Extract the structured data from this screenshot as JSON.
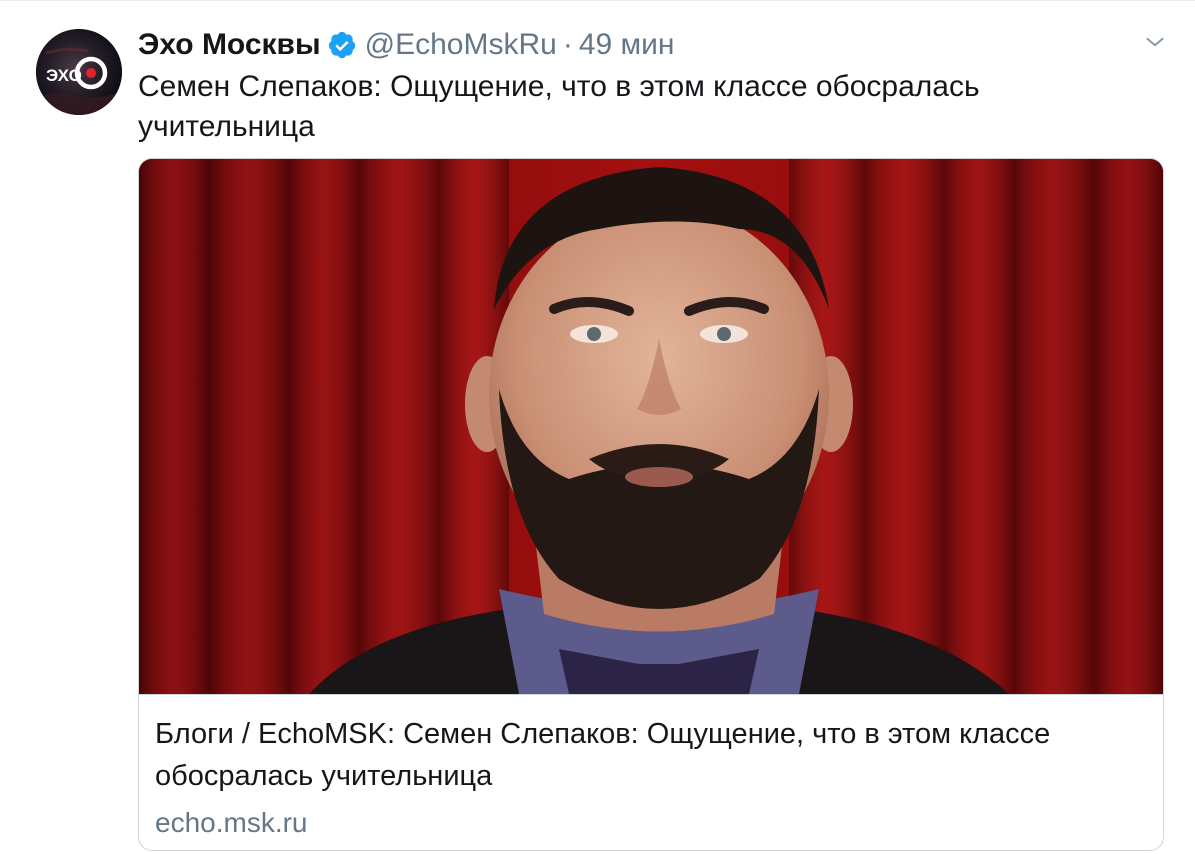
{
  "tweet": {
    "author_name": "Эхо Москвы",
    "handle": "@EchoMskRu",
    "separator": "·",
    "time": "49 мин",
    "text": "Семен Слепаков: Ощущение, что в этом классе обосралась учительница",
    "avatar_logo_text": "ЭХО",
    "icons": {
      "verified": "verified-badge-icon",
      "menu": "chevron-down-icon"
    }
  },
  "card": {
    "title": "Блоги / EchoMSK: Семен Слепаков: Ощущение, что в этом классе обосралась учительница",
    "domain": "echo.msk.ru"
  },
  "colors": {
    "text_primary": "#14171a",
    "text_secondary": "#657786",
    "verified_blue": "#1da1f2",
    "border": "#ccd6dd",
    "curtain_red": "#9e0e12"
  }
}
